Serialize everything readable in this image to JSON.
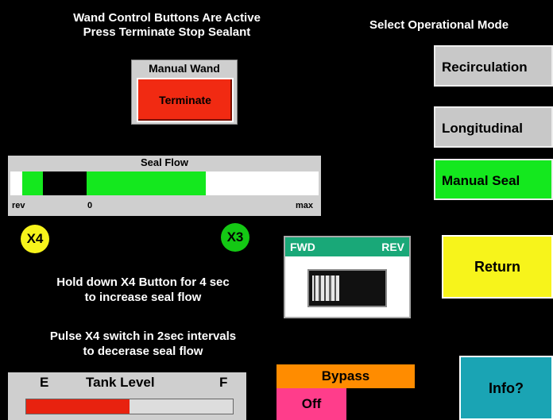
{
  "header": {
    "line1": "Wand Control Buttons Are Active",
    "line2": "Press Terminate Stop Sealant",
    "mode_title": "Select Operational Mode"
  },
  "manual_wand": {
    "title": "Manual Wand",
    "terminate_label": "Terminate"
  },
  "modes": [
    {
      "label": "Recirculation",
      "color": "#c8c8c8"
    },
    {
      "label": "Longitudinal",
      "color": "#c8c8c8"
    },
    {
      "label": "Manual Seal",
      "color": "#14e81e"
    }
  ],
  "seal_flow": {
    "title": "Seal Flow",
    "tick_rev": "rev",
    "tick_zero": "0",
    "tick_max": "max",
    "green_color": "#14e81e"
  },
  "x4": {
    "label": "X4",
    "color": "#f7f41b"
  },
  "x3": {
    "label": "X3",
    "color": "#14c814"
  },
  "fwd_rev": {
    "fwd": "FWD",
    "rev": "REV"
  },
  "return_label": "Return",
  "instructions": {
    "hold_line1": "Hold down X4 Button for 4 sec",
    "hold_line2": "to increase seal flow",
    "pulse_line1": "Pulse X4 switch in 2sec intervals",
    "pulse_line2": "to decerase seal flow"
  },
  "tank": {
    "e": "E",
    "title": "Tank Level",
    "f": "F",
    "level": 0.5,
    "fill_color": "#e8220f"
  },
  "bypass": {
    "label": "Bypass",
    "state": "Off"
  },
  "info_label": "Info?"
}
